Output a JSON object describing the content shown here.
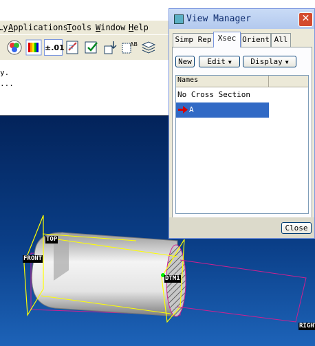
{
  "menu": {
    "items": [
      {
        "underline": "",
        "rest": "…y"
      },
      {
        "underline": "A",
        "rest": "pplications"
      },
      {
        "underline": "T",
        "rest": "ools"
      },
      {
        "underline": "W",
        "rest": "indow"
      },
      {
        "underline": "H",
        "rest": "elp"
      }
    ]
  },
  "toolbar": {
    "precision_label": "±.01"
  },
  "message_area": {
    "lines": [
      "y.",
      "..."
    ]
  },
  "datums": {
    "top": "TOP",
    "front": "FRONT",
    "dtm1": "DTM1",
    "right": "RIGHT"
  },
  "view_manager": {
    "title": "View Manager",
    "tabs": [
      "Simp Rep",
      "Xsec",
      "Orient",
      "All"
    ],
    "active_tab": "Xsec",
    "buttons": {
      "new": "New",
      "edit": "Edit",
      "display": "Display",
      "close": "Close"
    },
    "list": {
      "column_header": "Names",
      "rows": [
        "No Cross Section",
        "A"
      ],
      "selected": "A"
    }
  },
  "colors": {
    "accent_select": "#316ac5",
    "datum_yellow": "#ffff00",
    "xsec_arrow": "#d40000"
  }
}
